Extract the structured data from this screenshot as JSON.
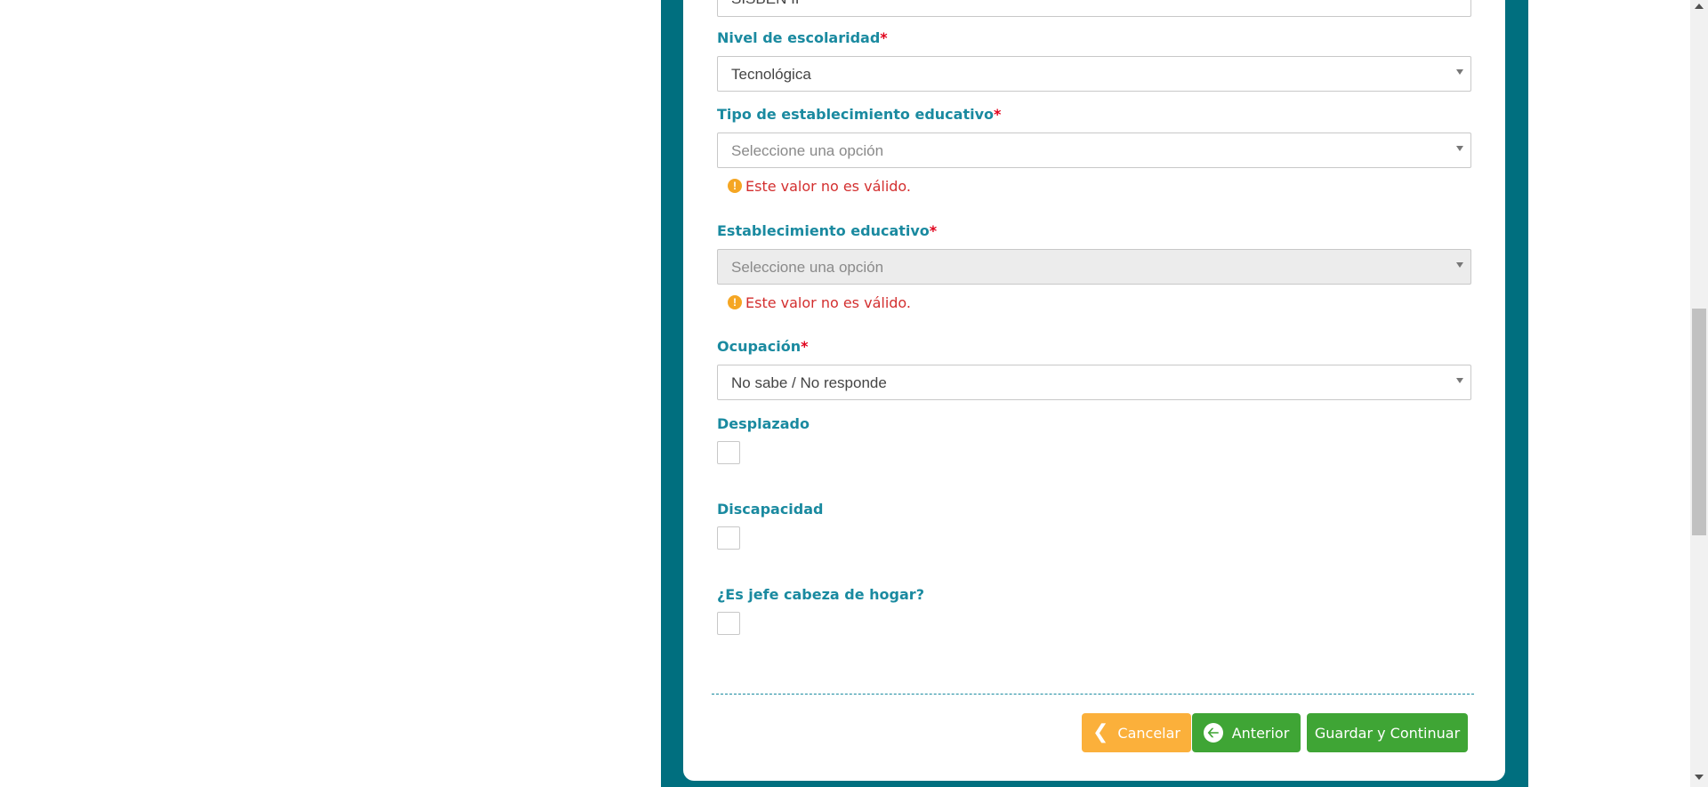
{
  "form": {
    "top_select": {
      "value": "SISBEN II"
    },
    "nivel_escolaridad": {
      "label": "Nivel de escolaridad",
      "required": "*",
      "value": "Tecnológica"
    },
    "tipo_establecimiento": {
      "label": "Tipo de establecimiento educativo",
      "required": "*",
      "placeholder": "Seleccione una opción",
      "error": "Este valor no es válido."
    },
    "establecimiento": {
      "label": "Establecimiento educativo",
      "required": "*",
      "placeholder": "Seleccione una opción",
      "error": "Este valor no es válido."
    },
    "ocupacion": {
      "label": "Ocupación",
      "required": "*",
      "value": "No sabe / No responde"
    },
    "desplazado": {
      "label": "Desplazado"
    },
    "discapacidad": {
      "label": "Discapacidad"
    },
    "jefe_hogar": {
      "label": "¿Es jefe cabeza de hogar?"
    }
  },
  "actions": {
    "cancel_label": "Cancelar",
    "previous_label": "Anterior",
    "save_label": "Guardar y Continuar"
  },
  "icons": {
    "warning": "exclamation-circle-icon",
    "cancel": "chevron-left-icon",
    "previous": "arrow-circle-left-icon"
  },
  "colors": {
    "panel": "#006f7f",
    "label": "#1a8aa0",
    "required": "#e0001b",
    "error": "#d32f2f",
    "cancel_button": "#fbb03b",
    "primary_button": "#3fa535"
  }
}
